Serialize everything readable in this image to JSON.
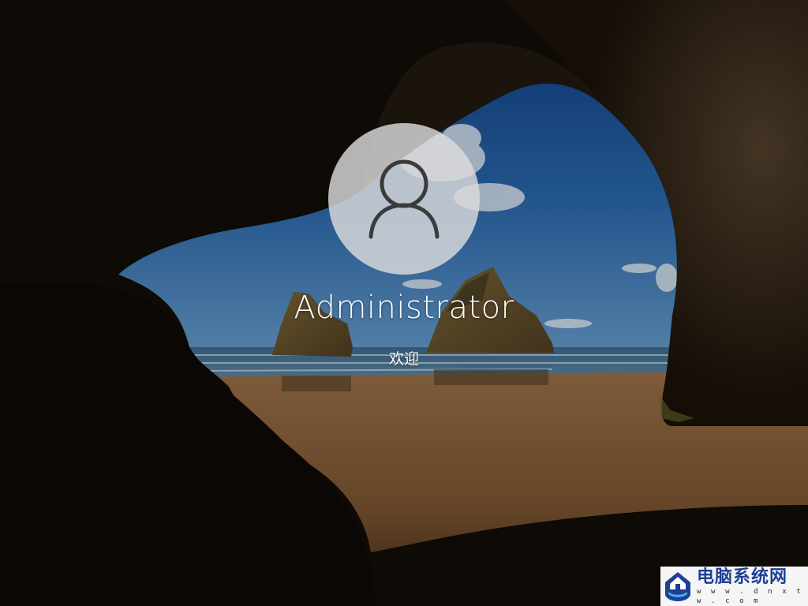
{
  "login": {
    "username": "Administrator",
    "status_text": "欢迎",
    "avatar_icon": "user-avatar-icon"
  },
  "background": {
    "description_icon": "cave-beach-wallpaper"
  },
  "watermark": {
    "title": "电脑系统网",
    "url": "w w w . d n x t w . c o m",
    "logo_icon": "house-shield-logo-icon"
  },
  "colors": {
    "sky_top": "#1b4f9c",
    "sky_bottom": "#5b93c6",
    "sand": "#8a6138",
    "cave": "#1a140f",
    "watermark_text": "#1d3f94"
  }
}
